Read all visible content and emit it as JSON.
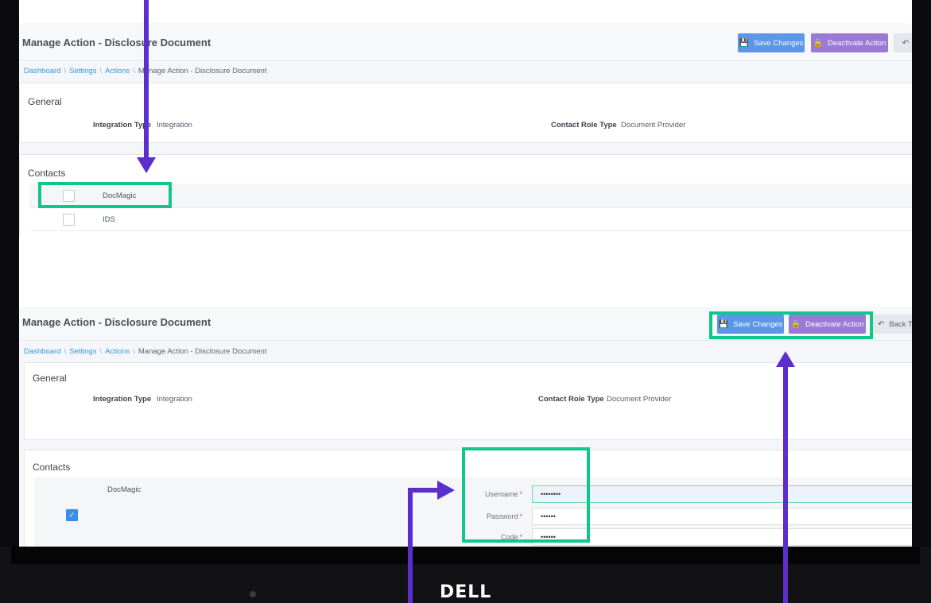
{
  "app": {
    "page_title": "Manage Action - Disclosure Document",
    "breadcrumb": [
      "Dashboard",
      "Settings",
      "Actions",
      "Manage Action - Disclosure Document"
    ],
    "save_label": "Save Changes",
    "deactivate_label": "Deactivate Action",
    "back_label": "Back To",
    "general": {
      "title": "General",
      "integration_type_label": "Integration Type",
      "integration_type_value": "Integration",
      "contact_role_type_label": "Contact Role Type",
      "contact_role_type_value": "Document Provider"
    },
    "contacts": {
      "title": "Contacts",
      "items": [
        {
          "name": "DocMagic",
          "checked": true
        },
        {
          "name": "IDS",
          "checked": false
        }
      ]
    },
    "credentials": {
      "username_label": "Username",
      "password_label": "Password",
      "code_label": "Code",
      "username_value": "••••••••",
      "password_value": "••••••",
      "code_value": "••••••",
      "required_mark": "*"
    }
  },
  "device": {
    "brand": "DELL"
  },
  "colors": {
    "highlight": "#10c68a",
    "arrow": "#5a2fcb",
    "save_button": "#5b96e8",
    "deactivate_button": "#9b7ad6",
    "link": "#3a98d8"
  },
  "icons": {
    "save": "floppy-disk-icon",
    "deactivate": "lock-icon",
    "back": "reply-arrow-icon",
    "checkbox": "check-icon"
  }
}
